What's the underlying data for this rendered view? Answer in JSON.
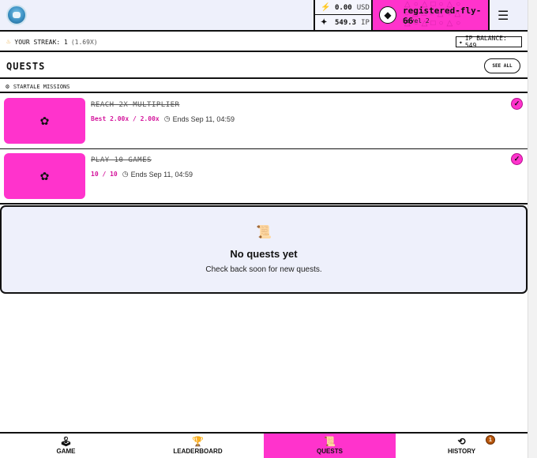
{
  "header": {
    "wallet": {
      "usd_value": "0.00",
      "usd_unit": "USD",
      "ip_value": "549.3",
      "ip_unit": "IP"
    },
    "user": {
      "username": "registered-fly-66",
      "level": "Level 2"
    }
  },
  "streak": {
    "label": "YOUR STREAK: 1",
    "multiplier": "(1.69X)",
    "ip_balance": "IP BALANCE: 549"
  },
  "quests": {
    "title": "QUESTS",
    "see_all": "SEE ALL",
    "section_label": "STARTALE MISSIONS",
    "items": [
      {
        "name": "REACH 2X MULTIPLIER",
        "progress": "Best 2.00x / 2.00x",
        "ends": "Ends Sep 11, 04:59",
        "completed": true
      },
      {
        "name": "PLAY 10 GAMES",
        "progress": "10 / 10",
        "ends": "Ends Sep 11, 04:59",
        "completed": true
      }
    ],
    "empty": {
      "title": "No quests yet",
      "subtitle": "Check back soon for new quests."
    }
  },
  "nav": {
    "items": [
      {
        "label": "GAME",
        "icon": "joystick-icon"
      },
      {
        "label": "LEADERBOARD",
        "icon": "trophy-icon"
      },
      {
        "label": "QUESTS",
        "icon": "scroll-icon",
        "active": true
      },
      {
        "label": "HISTORY",
        "icon": "history-icon",
        "badge": "1"
      }
    ]
  },
  "colors": {
    "accent_pink": "#ff33cc",
    "panel_bg": "#eef0fb",
    "progress_text": "#d4159c",
    "badge": "#b8560b"
  }
}
